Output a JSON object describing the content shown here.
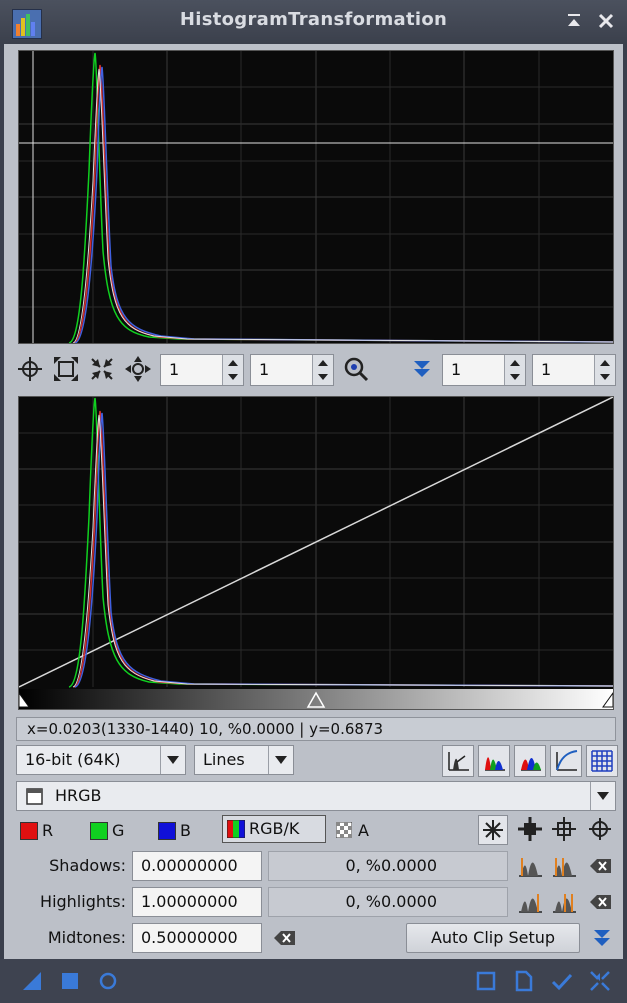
{
  "window": {
    "title": "HistogramTransformation"
  },
  "toolbar": {
    "h_zoom": "1",
    "v_zoom": "1",
    "h_zoom2": "1",
    "v_zoom2": "1"
  },
  "readout": "x=0.0203(1330-1440) 10, %0.0000 | y=0.6873",
  "resolution": {
    "value": "16-bit (64K)"
  },
  "graph_style": {
    "value": "Lines"
  },
  "view": {
    "value": "HRGB"
  },
  "channels": [
    {
      "label": "R",
      "color": "#e01010"
    },
    {
      "label": "G",
      "color": "#10d020"
    },
    {
      "label": "B",
      "color": "#1010d8"
    },
    {
      "label": "RGB/K",
      "color": "multi"
    },
    {
      "label": "A",
      "color": "checker"
    }
  ],
  "shadows": {
    "label": "Shadows:",
    "value": "0.00000000",
    "clip": "0, %0.0000"
  },
  "highlights": {
    "label": "Highlights:",
    "value": "1.00000000",
    "clip": "0, %0.0000"
  },
  "midtones": {
    "label": "Midtones:",
    "value": "0.50000000"
  },
  "auto_clip": {
    "label": "Auto Clip Setup"
  },
  "colors": {
    "red": "#e01010",
    "green": "#10d020",
    "blue": "#1010d8",
    "accent": "#1f5fc0",
    "curve": "#d8d8d8"
  },
  "icons": {
    "title": [
      "histogram-app-icon",
      "shade-icon",
      "close-icon"
    ],
    "toolbar": [
      "crosshair-icon",
      "zoom-fit-icon",
      "zoom-out-icon",
      "pan-icon",
      "zoom-icon",
      "expand-icon"
    ],
    "graph_buttons": [
      "reject-icon",
      "histogram-color-icon",
      "histogram-combined-icon",
      "curve-icon",
      "grid-icon"
    ],
    "channel_tools": [
      "reset-icon",
      "select-icon",
      "pointer-icon",
      "target-icon"
    ],
    "bottom": [
      "new-instance-icon",
      "apply-global-icon",
      "real-time-preview-icon",
      "preview-icon",
      "document-icon",
      "apply-icon",
      "reset-all-icon"
    ]
  }
}
